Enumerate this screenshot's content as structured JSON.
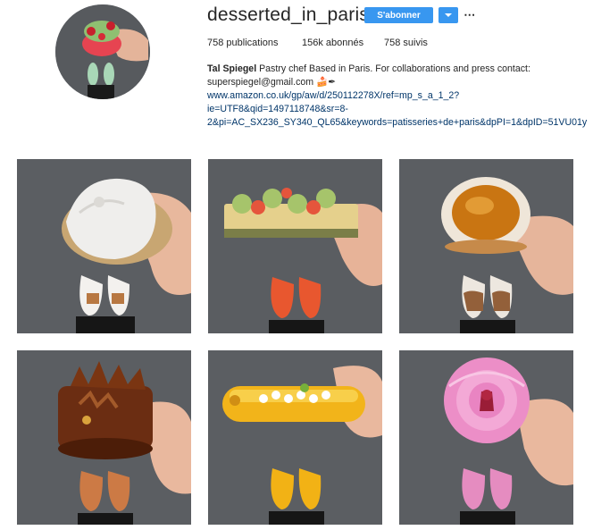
{
  "profile": {
    "username": "desserted_in_paris",
    "follow_label": "S'abonner",
    "stats": {
      "posts": "758 publications",
      "followers": "156k abonnés",
      "following": "758 suivis"
    },
    "bio": {
      "name": "Tal Spiegel",
      "line1_rest": " Pastry chef Based in Paris. For collaborations and press contact:",
      "line2": "superspiegel@gmail.com 🍰✒",
      "link_line1": "www.amazon.co.uk/gp/aw/d/250112278X/ref=mp_s_a_1_2?",
      "link_line2": "ie=UTF8&qid=1497118748&sr=8-",
      "link_line3": "2&pi=AC_SX236_SY340_QL65&keywords=patisseries+de+paris&dpPI=1&dpID=51VU01y"
    }
  },
  "icons": {
    "dropdown": "chevron-down-icon",
    "more": "more-options-icon"
  },
  "colors": {
    "accent": "#3897f0",
    "link": "#003569",
    "text": "#262626",
    "ground": "#5c5f63"
  },
  "posts": [
    {
      "dessert": "white sculpted cream cake",
      "shoes": "white brogues"
    },
    {
      "dessert": "pistachio strawberry slice",
      "shoes": "orange brogues"
    },
    {
      "dessert": "apricot tart",
      "shoes": "beige and brown brogues"
    },
    {
      "dessert": "chocolate leaf cake",
      "shoes": "tan brogues"
    },
    {
      "dessert": "lemon meringue eclair",
      "shoes": "yellow brogues"
    },
    {
      "dessert": "pink swirl meringue",
      "shoes": "pink brogues"
    }
  ]
}
